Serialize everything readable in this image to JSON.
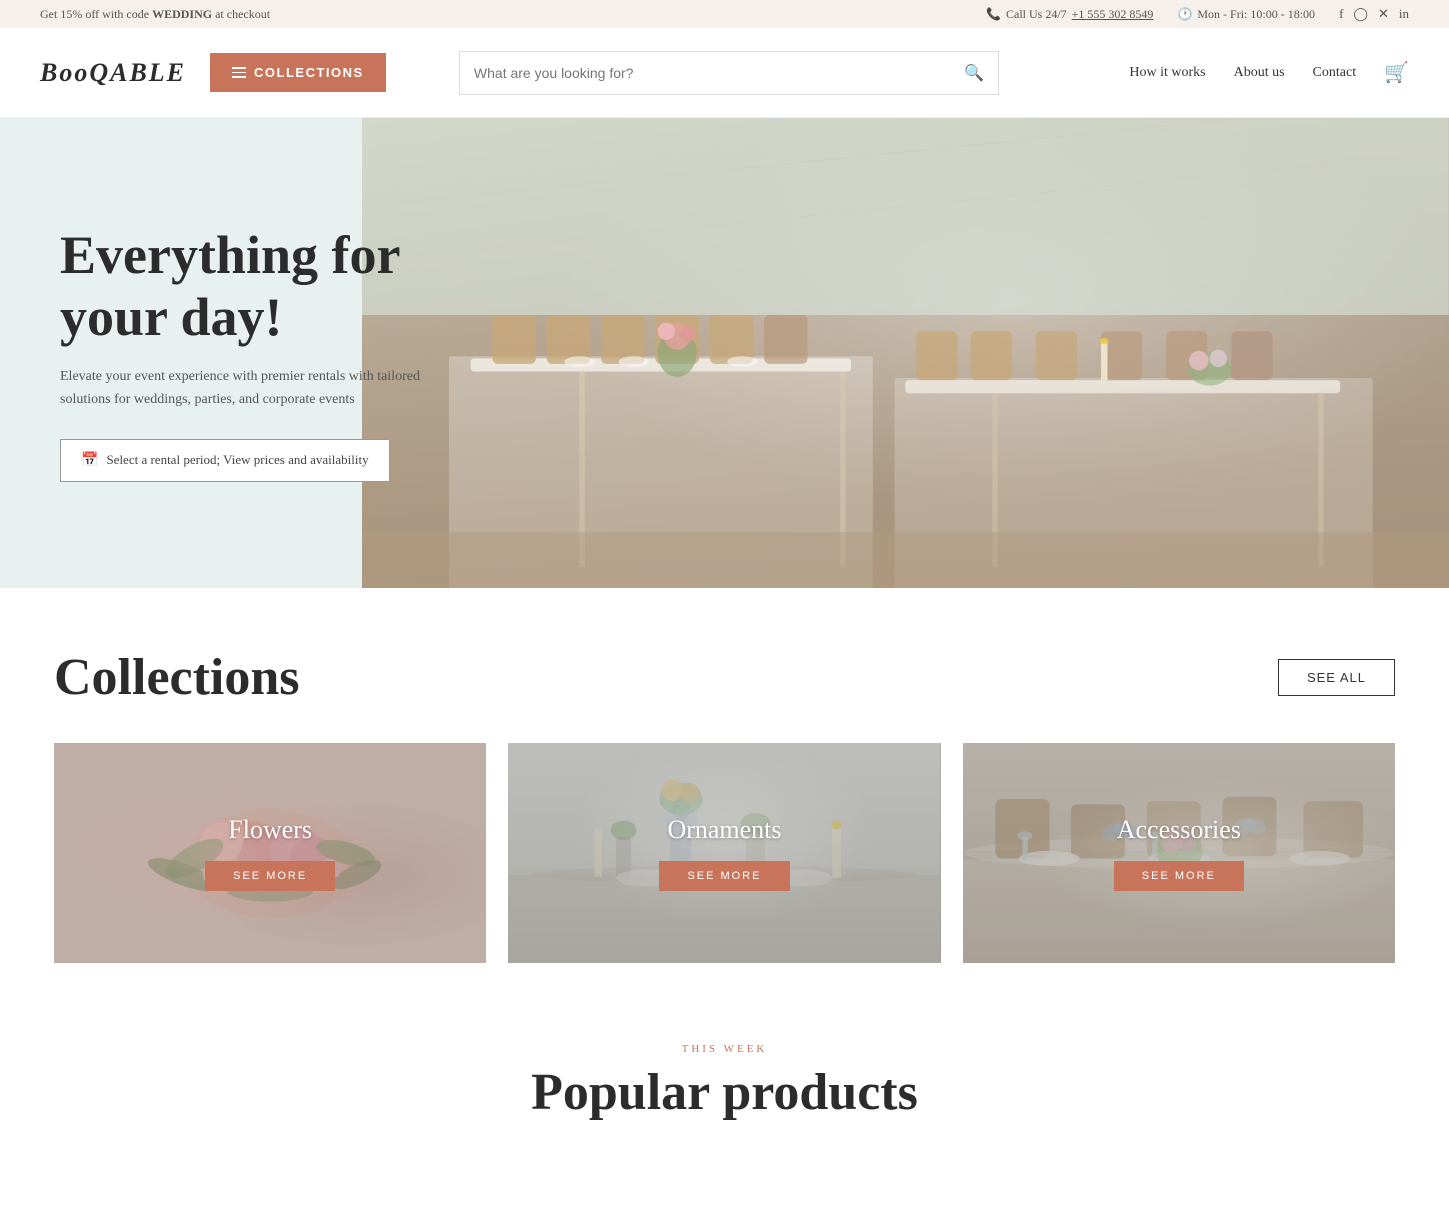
{
  "topbar": {
    "promo_text": "Get 15% off with code ",
    "promo_code": "WEDDING",
    "promo_suffix": " at checkout",
    "phone_label": "Call Us 24/7",
    "phone_number": "+1 555 302 8549",
    "hours": "Mon - Fri: 10:00 - 18:00",
    "social": [
      "facebook",
      "instagram",
      "x",
      "linkedin"
    ]
  },
  "header": {
    "logo": "BOOQABLE",
    "collections_btn": "COLLECTIONS",
    "search_placeholder": "What are you looking for?",
    "nav_items": [
      "How it works",
      "About us",
      "Contact"
    ]
  },
  "hero": {
    "title": "Everything for your day!",
    "subtitle": "Elevate your event experience with premier rentals with tailored solutions for weddings, parties, and corporate events",
    "cta_label": "Select a rental period; View prices and availability"
  },
  "collections": {
    "title": "Collections",
    "see_all_label": "SEE ALL",
    "cards": [
      {
        "name": "Flowers",
        "see_more": "SEE MORE",
        "type": "flowers"
      },
      {
        "name": "Ornaments",
        "see_more": "SEE MORE",
        "type": "ornaments"
      },
      {
        "name": "Accessories",
        "see_more": "SEE MORE",
        "type": "accessories"
      }
    ]
  },
  "this_week": {
    "label": "THIS WEEK",
    "title": "Popular products"
  }
}
